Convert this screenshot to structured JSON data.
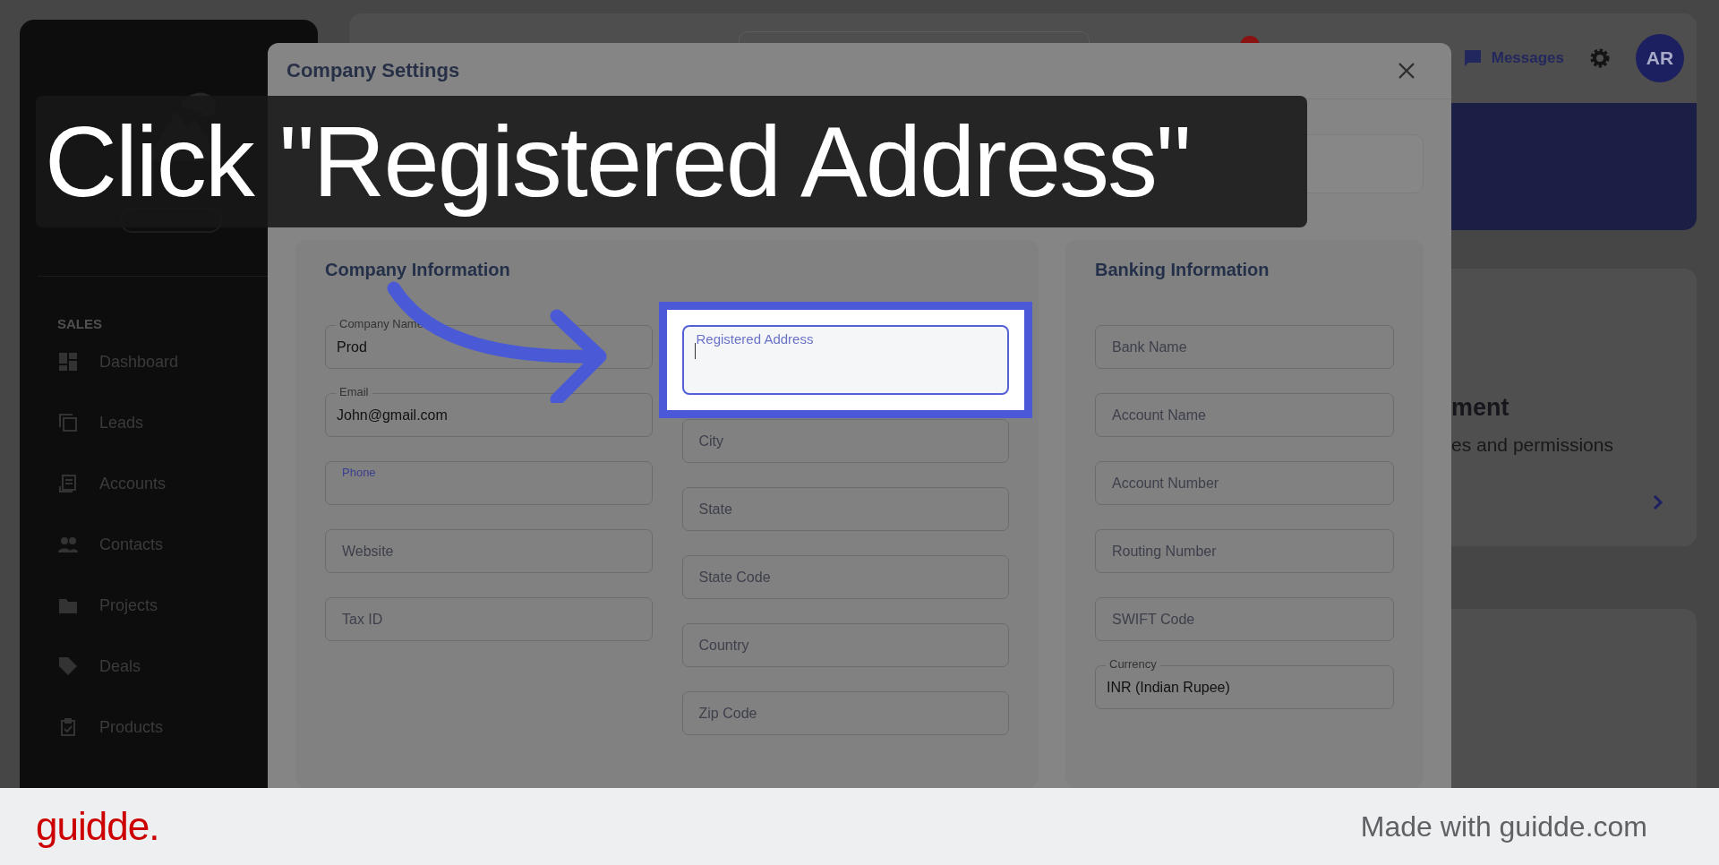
{
  "guide": {
    "caption": "Click \"Registered Address\""
  },
  "sidebar": {
    "section": "SALES",
    "items": [
      {
        "label": "Dashboard",
        "kind": "dashboard"
      },
      {
        "label": "Leads",
        "kind": "calculator"
      },
      {
        "label": "Accounts",
        "kind": "receipt"
      },
      {
        "label": "Contacts",
        "kind": "people"
      },
      {
        "label": "Projects",
        "kind": "folder"
      },
      {
        "label": "Deals",
        "kind": "tag"
      },
      {
        "label": "Products",
        "kind": "clipboard"
      }
    ]
  },
  "header": {
    "messages": "Messages",
    "avatar": "AR"
  },
  "background_card": {
    "title": "ment",
    "text": "es and permissions"
  },
  "modal": {
    "title": "Company Settings",
    "sections": [
      {
        "title": "Company Information",
        "columns": [
          [
            {
              "label": "Company Name",
              "value": "Prod",
              "kind": "filled"
            },
            {
              "label": "Email",
              "value": "John@gmail.com",
              "kind": "filled"
            },
            {
              "label": "Phone",
              "kind": "label"
            },
            {
              "label": "Website",
              "kind": "empty"
            },
            {
              "label": "Tax ID",
              "kind": "empty"
            }
          ],
          [
            {
              "label": "Registered Address",
              "kind": "focused"
            },
            {
              "label": "City",
              "kind": "empty"
            },
            {
              "label": "State",
              "kind": "empty"
            },
            {
              "label": "State Code",
              "kind": "empty"
            },
            {
              "label": "Country",
              "kind": "empty"
            },
            {
              "label": "Zip Code",
              "kind": "empty"
            }
          ]
        ]
      },
      {
        "title": "Banking Information",
        "columns": [
          [
            {
              "label": "Bank Name",
              "kind": "empty"
            },
            {
              "label": "Account Name",
              "kind": "empty"
            },
            {
              "label": "Account Number",
              "kind": "empty"
            },
            {
              "label": "Routing Number",
              "kind": "empty"
            },
            {
              "label": "SWIFT Code",
              "kind": "empty"
            },
            {
              "label": "Currency",
              "value": "INR (Indian Rupee)",
              "kind": "filled"
            }
          ]
        ]
      }
    ]
  },
  "footer": {
    "logo": "guidde.",
    "credit": "Made with guidde.com"
  }
}
